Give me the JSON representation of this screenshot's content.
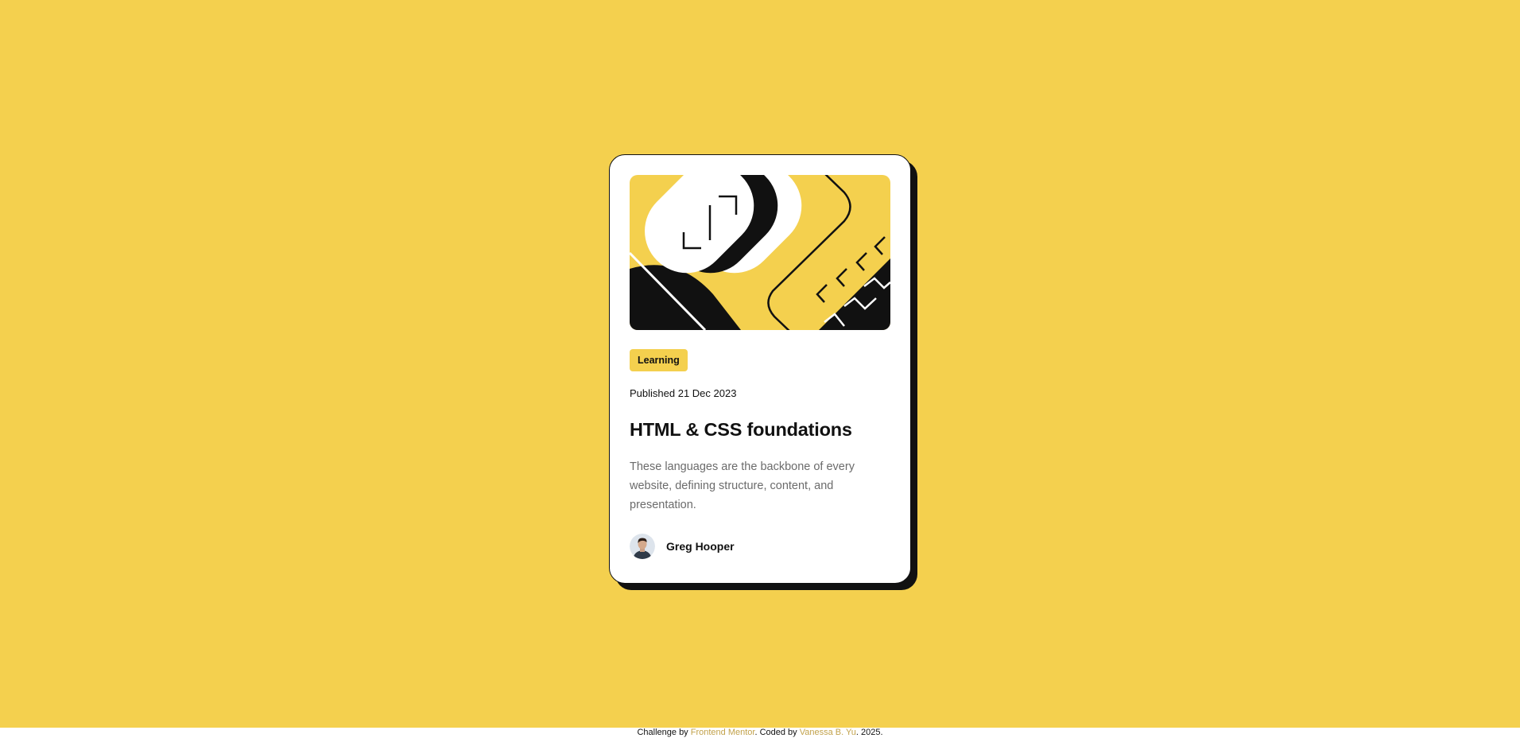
{
  "card": {
    "category": "Learning",
    "published": "Published 21 Dec 2023",
    "title": "HTML & CSS foundations",
    "description": "These languages are the backbone of every website, defining structure, content, and presentation.",
    "author": "Greg Hooper"
  },
  "footer": {
    "prefix": "Challenge by ",
    "challenge_link": "Frontend Mentor",
    "middle": ". Coded by ",
    "author_link": "Vanessa B. Yu",
    "suffix": ". 2025."
  },
  "colors": {
    "background": "#F4D04E",
    "card": "#FFFFFF",
    "ink": "#111111",
    "muted_text": "#6B6B6B",
    "link": "#C2A24B"
  },
  "icons": {
    "hero": "abstract-illustration",
    "avatar": "author-avatar"
  }
}
